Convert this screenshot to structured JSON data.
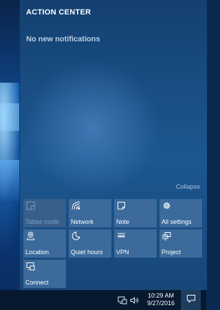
{
  "action_center": {
    "title": "ACTION CENTER",
    "empty_message": "No new notifications",
    "collapse_label": "Collapse"
  },
  "quick_actions": [
    {
      "label": "Tablet mode",
      "icon": "tablet-mode-icon",
      "enabled": false
    },
    {
      "label": "Network",
      "icon": "network-icon",
      "enabled": true
    },
    {
      "label": "Note",
      "icon": "note-icon",
      "enabled": true
    },
    {
      "label": "All settings",
      "icon": "gear-icon",
      "enabled": true
    },
    {
      "label": "Location",
      "icon": "location-icon",
      "enabled": true
    },
    {
      "label": "Quiet hours",
      "icon": "moon-icon",
      "enabled": true
    },
    {
      "label": "VPN",
      "icon": "vpn-icon",
      "enabled": true
    },
    {
      "label": "Project",
      "icon": "project-icon",
      "enabled": true
    },
    {
      "label": "Connect",
      "icon": "connect-icon",
      "enabled": true
    }
  ],
  "taskbar": {
    "time": "10:29 AM",
    "date": "9/27/2016"
  },
  "colors": {
    "panel": "#1a4f86",
    "tile": "#3b6a9b",
    "taskbar": "#07192f"
  }
}
